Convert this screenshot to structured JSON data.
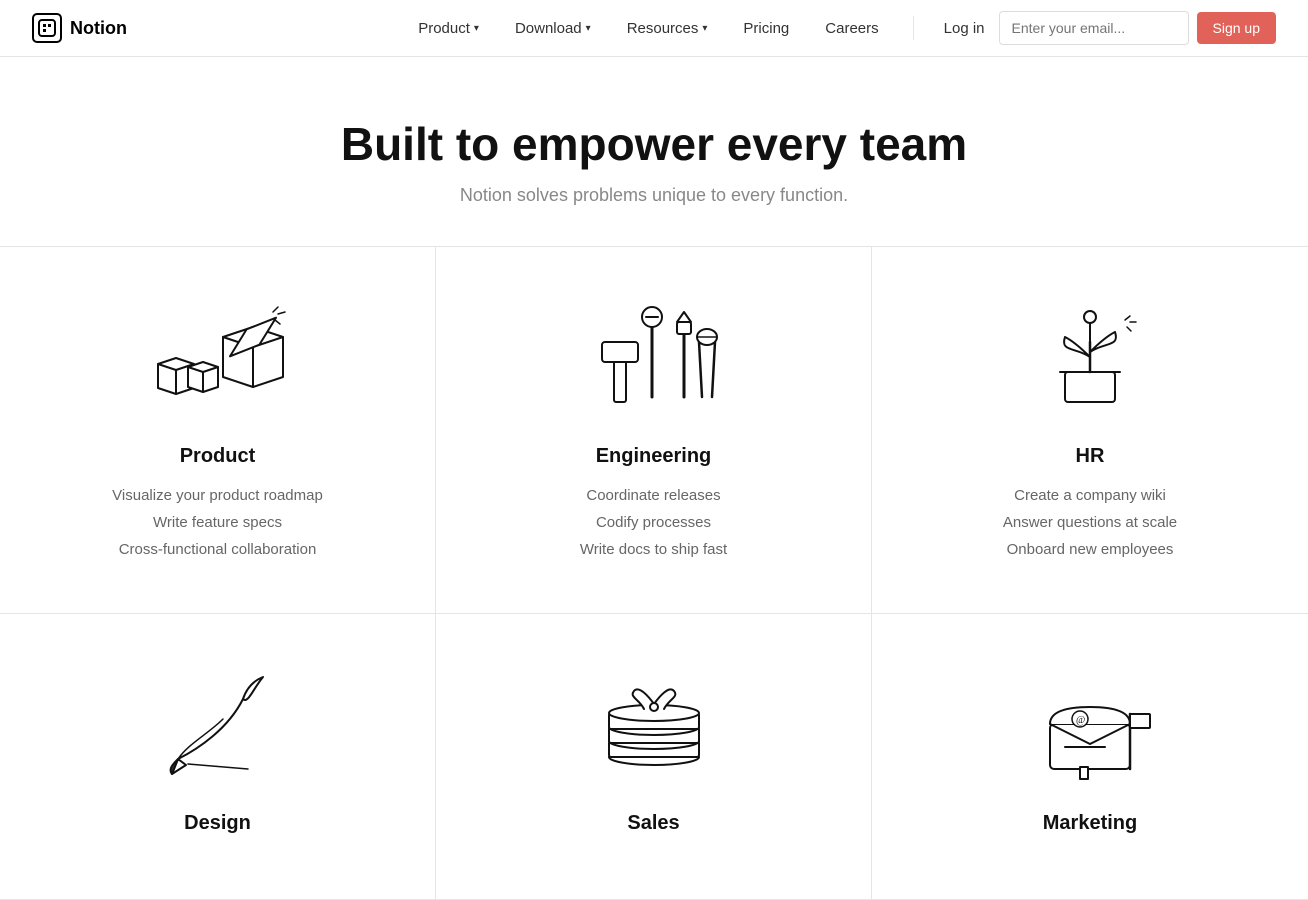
{
  "nav": {
    "logo_text": "Notion",
    "links": [
      {
        "label": "Product",
        "has_dropdown": true
      },
      {
        "label": "Download",
        "has_dropdown": true
      },
      {
        "label": "Resources",
        "has_dropdown": true
      },
      {
        "label": "Pricing",
        "has_dropdown": false
      },
      {
        "label": "Careers",
        "has_dropdown": false
      }
    ],
    "login_label": "Log in",
    "email_placeholder": "Enter your email...",
    "signup_label": "Sign up"
  },
  "hero": {
    "title": "Built to empower every team",
    "subtitle": "Notion solves problems unique to every function."
  },
  "grid": [
    {
      "id": "product",
      "title": "Product",
      "lines": [
        "Visualize your product roadmap",
        "Write feature specs",
        "Cross-functional collaboration"
      ]
    },
    {
      "id": "engineering",
      "title": "Engineering",
      "lines": [
        "Coordinate releases",
        "Codify processes",
        "Write docs to ship fast"
      ]
    },
    {
      "id": "hr",
      "title": "HR",
      "lines": [
        "Create a company wiki",
        "Answer questions at scale",
        "Onboard new employees"
      ]
    },
    {
      "id": "design",
      "title": "Design",
      "lines": []
    },
    {
      "id": "sales",
      "title": "Sales",
      "lines": []
    },
    {
      "id": "marketing",
      "title": "Marketing",
      "lines": []
    }
  ]
}
